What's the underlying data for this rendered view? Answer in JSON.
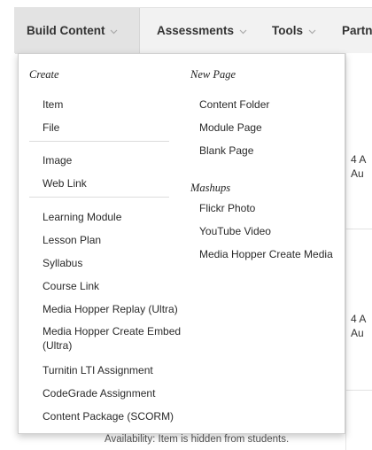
{
  "toolbar": {
    "tabs": [
      {
        "label": "Build Content"
      },
      {
        "label": "Assessments"
      },
      {
        "label": "Tools"
      },
      {
        "label": "Partn"
      }
    ]
  },
  "menu": {
    "create": {
      "heading": "Create",
      "items": [
        "Item",
        "File",
        "Image",
        "Web Link",
        "Learning Module",
        "Lesson Plan",
        "Syllabus",
        "Course Link",
        "Media Hopper Replay (Ultra)",
        "Media Hopper Create Embed (Ultra)",
        "Turnitin LTI Assignment",
        "CodeGrade Assignment",
        "Content Package (SCORM)"
      ]
    },
    "new_page": {
      "heading": "New Page",
      "items": [
        "Content Folder",
        "Module Page",
        "Blank Page"
      ]
    },
    "mashups": {
      "heading": "Mashups",
      "items": [
        "Flickr Photo",
        "YouTube Video",
        "Media Hopper Create Media"
      ]
    }
  },
  "background": {
    "row1_a": "4 A",
    "row1_b": "Au",
    "row2_a": "4 A",
    "row2_b": "Au",
    "availability": "Availability:  Item is hidden from students."
  },
  "icons": {
    "tab_chevron": "chevron-down-icon"
  },
  "colors": {
    "toolbar_bg": "#f2f2f2",
    "active_tab_bg": "#e3e3e3",
    "menu_border": "#cfcfcf"
  }
}
